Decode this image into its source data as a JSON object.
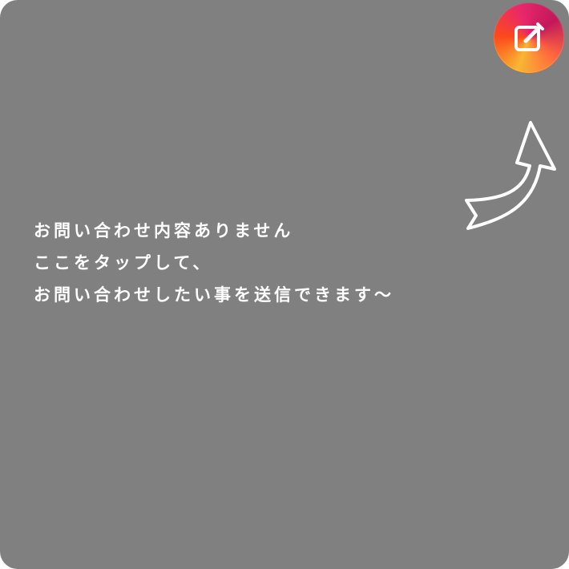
{
  "overlay": {
    "background_color": "#808080",
    "message_lines": [
      "お問い合わせ内容ありません",
      "ここをタップして、",
      "お問い合わせしたい事を送信できます～"
    ]
  },
  "compose_button": {
    "icon": "edit-icon",
    "colors": [
      "#f7b733",
      "#fc4a1a",
      "#e8276c",
      "#c2185b"
    ]
  },
  "hint_arrow": {
    "icon": "curved-arrow-up-icon",
    "color": "#ffffff"
  }
}
